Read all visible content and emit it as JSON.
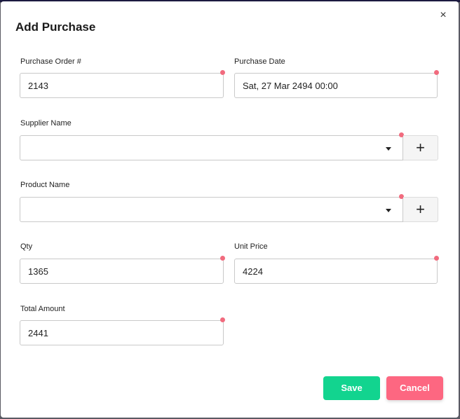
{
  "dialog": {
    "title": "Add Purchase",
    "close_glyph": "×"
  },
  "fields": {
    "purchase_order": {
      "label": "Purchase Order #",
      "value": "2143"
    },
    "purchase_date": {
      "label": "Purchase Date",
      "value": "Sat, 27 Mar 2494 00:00"
    },
    "supplier_name": {
      "label": "Supplier Name",
      "value": "",
      "add_glyph": "+"
    },
    "product_name": {
      "label": "Product Name",
      "value": "",
      "add_glyph": "+"
    },
    "qty": {
      "label": "Qty",
      "value": "1365"
    },
    "unit_price": {
      "label": "Unit Price",
      "value": "4224"
    },
    "total_amount": {
      "label": "Total Amount",
      "value": "2441"
    }
  },
  "actions": {
    "save_label": "Save",
    "cancel_label": "Cancel"
  },
  "colors": {
    "save": "#12d48f",
    "cancel": "#fd6781",
    "required_dot": "#f16b7e",
    "top_strip": "#1c1a40"
  }
}
